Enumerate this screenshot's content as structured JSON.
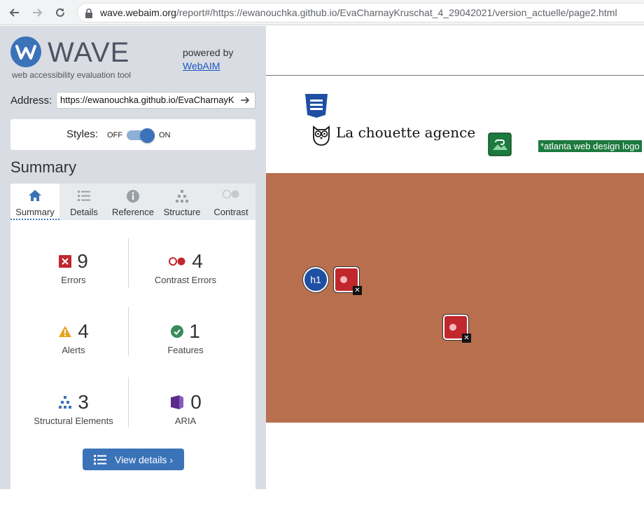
{
  "browser": {
    "url_domain": "wave.webaim.org",
    "url_rest": "/report#/https://ewanouchka.github.io/EvaCharnayKruschat_4_29042021/version_actuelle/page2.html"
  },
  "wave": {
    "logo_text": "WAVE",
    "tagline": "web accessibility evaluation tool",
    "powered_by": "powered by",
    "webaim_link": "WebAIM",
    "address_label": "Address:",
    "address_value": "https://ewanouchka.github.io/EvaCharnayK",
    "styles_label": "Styles:",
    "styles_off": "OFF",
    "styles_on": "ON",
    "summary_title": "Summary",
    "tabs": [
      {
        "label": "Summary",
        "icon": "home-icon",
        "active": true
      },
      {
        "label": "Details",
        "icon": "list-icon"
      },
      {
        "label": "Reference",
        "icon": "info-icon"
      },
      {
        "label": "Structure",
        "icon": "structure-icon"
      },
      {
        "label": "Contrast",
        "icon": "contrast-icon"
      }
    ],
    "stats": [
      {
        "count": "9",
        "label": "Errors",
        "icon": "error-icon"
      },
      {
        "count": "4",
        "label": "Contrast Errors",
        "icon": "contrast-error-icon"
      },
      {
        "count": "4",
        "label": "Alerts",
        "icon": "alert-icon"
      },
      {
        "count": "1",
        "label": "Features",
        "icon": "feature-icon"
      },
      {
        "count": "3",
        "label": "Structural Elements",
        "icon": "structure-icon"
      },
      {
        "count": "0",
        "label": "ARIA",
        "icon": "aria-icon"
      }
    ],
    "view_details": "View details ›"
  },
  "preview": {
    "brand_text": "La chouette agence",
    "alt_text": "*atlanta web design logo",
    "h1_label": "h1"
  },
  "colors": {
    "wave_blue": "#3b73b9",
    "error_red": "#c1272d",
    "hero_brown": "#b86f4d",
    "feature_green": "#1d7a3f"
  }
}
